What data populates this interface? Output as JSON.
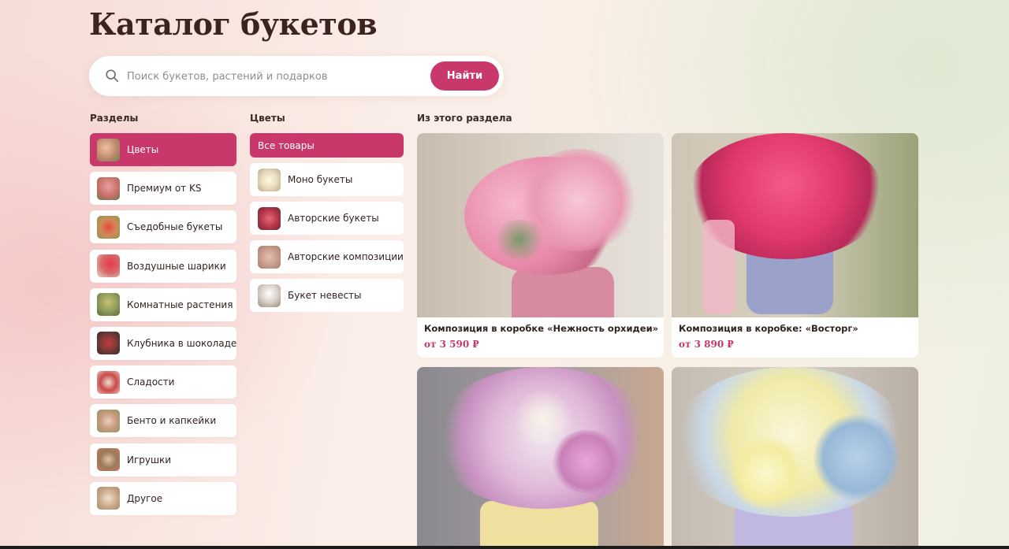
{
  "page": {
    "title": "Каталог букетов"
  },
  "search": {
    "placeholder": "Поиск букетов, растений и подарков",
    "button_label": "Найти"
  },
  "sections": {
    "heading": "Разделы",
    "items": [
      {
        "label": "Цветы",
        "active": true,
        "thumb_color": "#b9856a"
      },
      {
        "label": "Премиум от KS",
        "active": false,
        "thumb_color": "#c9706a"
      },
      {
        "label": "Съедобные букеты",
        "active": false,
        "thumb_color": "#d08a5a"
      },
      {
        "label": "Воздушные шарики",
        "active": false,
        "thumb_color": "#d66a6a"
      },
      {
        "label": "Комнатные растения",
        "active": false,
        "thumb_color": "#8a9a5a"
      },
      {
        "label": "Клубника в шоколаде",
        "active": false,
        "thumb_color": "#7a3a3a"
      },
      {
        "label": "Сладости",
        "active": false,
        "thumb_color": "#c94a4a"
      },
      {
        "label": "Бенто и капкейки",
        "active": false,
        "thumb_color": "#c99a7a"
      },
      {
        "label": "Игрушки",
        "active": false,
        "thumb_color": "#9a7a5a"
      },
      {
        "label": "Другое",
        "active": false,
        "thumb_color": "#c9a98a"
      }
    ]
  },
  "subcategories": {
    "heading": "Цветы",
    "all_label": "Все товары",
    "items": [
      {
        "label": "Моно букеты",
        "thumb_color": "#e8dcc0"
      },
      {
        "label": "Авторские букеты",
        "thumb_color": "#b8384a"
      },
      {
        "label": "Авторские композиции",
        "thumb_color": "#c9a090"
      },
      {
        "label": "Букет невесты",
        "thumb_color": "#d8d0c8"
      }
    ]
  },
  "products": {
    "heading": "Из этого раздела",
    "items": [
      {
        "name": "Композиция в коробке «Нежность орхидеи»",
        "price": "от 3 590 ₽"
      },
      {
        "name": "Композиция в коробке: «Восторг»",
        "price": "от 3 890 ₽"
      },
      {
        "name": "",
        "price": ""
      },
      {
        "name": "",
        "price": ""
      }
    ]
  },
  "colors": {
    "accent": "#c8386a",
    "title": "#3b2420"
  }
}
